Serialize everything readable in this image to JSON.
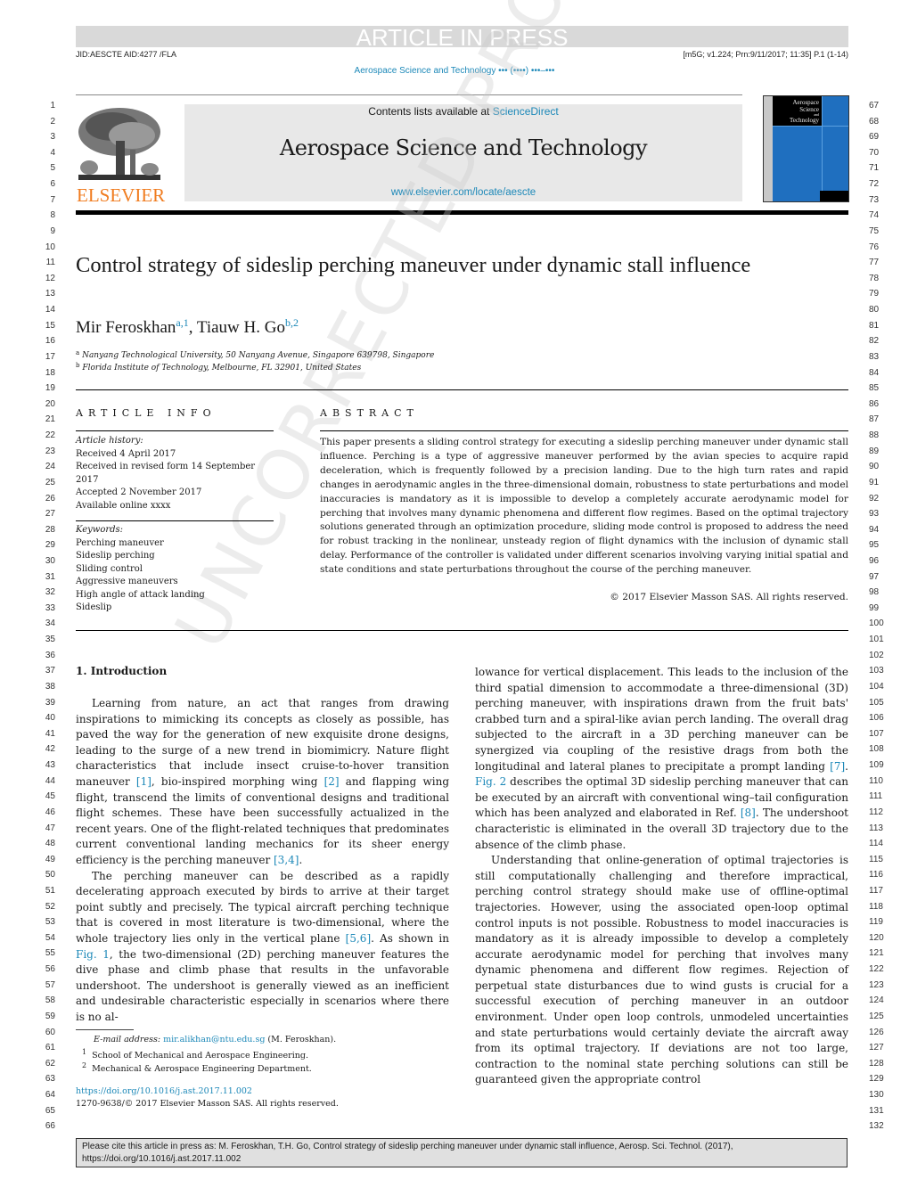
{
  "banner": "ARTICLE IN PRESS",
  "meta_left": "JID:AESCTE   AID:4277 /FLA",
  "meta_right": "[m5G; v1.224; Prn:9/11/2017; 11:35] P.1 (1-14)",
  "running_header": "Aerospace Science and Technology ••• (••••) •••–•••",
  "masthead": {
    "contents_prefix": "Contents lists available at ",
    "contents_link": "ScienceDirect",
    "journal_title": "Aerospace Science and Technology",
    "journal_url": "www.elsevier.com/locate/aescte",
    "publisher_logo": "ELSEVIER",
    "cover_title_1": "Aerospace",
    "cover_title_2": "Science",
    "cover_title_3": "and",
    "cover_title_4": "Technology",
    "publisher_color": "#f07c1f",
    "link_color": "#1c88b8"
  },
  "watermark": "UNCORRECTED PROOF",
  "article": {
    "title": "Control strategy of sideslip perching maneuver under dynamic stall influence",
    "authors": [
      {
        "name": "Mir Feroskhan",
        "sup": "a,1"
      },
      {
        "name": "Tiauw H. Go",
        "sup": "b,2"
      }
    ],
    "affiliations": [
      {
        "mark": "a",
        "text": "Nanyang Technological University, 50 Nanyang Avenue, Singapore 639798, Singapore"
      },
      {
        "mark": "b",
        "text": "Florida Institute of Technology, Melbourne, FL 32901, United States"
      }
    ]
  },
  "article_info": {
    "heading": "ARTICLE INFO",
    "history_label": "Article history:",
    "history": [
      "Received 4 April 2017",
      "Received in revised form 14 September 2017",
      "Accepted 2 November 2017",
      "Available online xxxx"
    ],
    "keywords_label": "Keywords:",
    "keywords": [
      "Perching maneuver",
      "Sideslip perching",
      "Sliding control",
      "Aggressive maneuvers",
      "High angle of attack landing",
      "Sideslip"
    ]
  },
  "abstract": {
    "heading": "ABSTRACT",
    "text": "This paper presents a sliding control strategy for executing a sideslip perching maneuver under dynamic stall influence. Perching is a type of aggressive maneuver performed by the avian species to acquire rapid deceleration, which is frequently followed by a precision landing. Due to the high turn rates and rapid changes in aerodynamic angles in the three-dimensional domain, robustness to state perturbations and model inaccuracies is mandatory as it is impossible to develop a completely accurate aerodynamic model for perching that involves many dynamic phenomena and different flow regimes. Based on the optimal trajectory solutions generated through an optimization procedure, sliding mode control is proposed to address the need for robust tracking in the nonlinear, unsteady region of flight dynamics with the inclusion of dynamic stall delay. Performance of the controller is validated under different scenarios involving varying initial spatial and state conditions and state perturbations throughout the course of the perching maneuver.",
    "copyright": "© 2017 Elsevier Masson SAS. All rights reserved."
  },
  "body": {
    "section_heading": "1. Introduction",
    "left_p1_a": "Learning from nature, an act that ranges from drawing inspirations to mimicking its concepts as closely as possible, has paved the way for the generation of new exquisite drone designs, leading to the surge of a new trend in biomimicry. Nature flight characteristics that include insect cruise-to-hover transition maneuver ",
    "ref1": "[1]",
    "left_p1_b": ", bio-inspired morphing wing ",
    "ref2": "[2]",
    "left_p1_c": " and flapping wing flight, transcend the limits of conventional designs and traditional flight schemes. These have been successfully actualized in the recent years. One of the flight-related techniques that predominates current conventional landing mechanics for its sheer energy efficiency is the perching maneuver ",
    "ref34": "[3,4]",
    "left_p1_d": ".",
    "left_p2_a": "The perching maneuver can be described as a rapidly decelerating approach executed by birds to arrive at their target point subtly and precisely. The typical aircraft perching technique that is covered in most literature is two-dimensional, where the whole trajectory lies only in the vertical plane ",
    "ref56": "[5,6]",
    "left_p2_b": ". As shown in ",
    "fig1": "Fig. 1",
    "left_p2_c": ", the two-dimensional (2D) perching maneuver features the dive phase and climb phase that results in the unfavorable undershoot. The undershoot is generally viewed as an inefficient and undesirable characteristic especially in scenarios where there is no al-",
    "right_p1_a": "lowance for vertical displacement. This leads to the inclusion of the third spatial dimension to accommodate a three-dimensional (3D) perching maneuver, with inspirations drawn from the fruit bats' crabbed turn and a spiral-like avian perch landing. The overall drag subjected to the aircraft in a 3D perching maneuver can be synergized via coupling of the resistive drags from both the longitudinal and lateral planes to precipitate a prompt landing ",
    "ref7": "[7]",
    "right_p1_b": ". ",
    "fig2": "Fig. 2",
    "right_p1_c": " describes the optimal 3D sideslip perching maneuver that can be executed by an aircraft with conventional wing–tail configuration which has been analyzed and elaborated in Ref. ",
    "ref8": "[8]",
    "right_p1_d": ". The undershoot characteristic is eliminated in the overall 3D trajectory due to the absence of the climb phase.",
    "right_p2": "Understanding that online-generation of optimal trajectories is still computationally challenging and therefore impractical, perching control strategy should make use of offline-optimal trajectories. However, using the associated open-loop optimal control inputs is not possible. Robustness to model inaccuracies is mandatory as it is already impossible to develop a completely accurate aerodynamic model for perching that involves many dynamic phenomena and different flow regimes. Rejection of perpetual state disturbances due to wind gusts is crucial for a successful execution of perching maneuver in an outdoor environment. Under open loop controls, unmodeled uncertainties and state perturbations would certainly deviate the aircraft away from its optimal trajectory. If deviations are not too large, contraction to the nominal state perching solutions can still be guaranteed given the appropriate control"
  },
  "footnotes": {
    "email_label": "E-mail address: ",
    "email": "mir.alikhan@ntu.edu.sg",
    "email_suffix": " (M. Feroskhan).",
    "fn1_mark": "1",
    "fn1": "School of Mechanical and Aerospace Engineering.",
    "fn2_mark": "2",
    "fn2": "Mechanical & Aerospace Engineering Department.",
    "doi": "https://doi.org/10.1016/j.ast.2017.11.002",
    "issn": "1270-9638/© 2017 Elsevier Masson SAS. All rights reserved."
  },
  "citation_box": {
    "line1": "Please cite this article in press as: M. Feroskhan, T.H. Go, Control strategy of sideslip perching maneuver under dynamic stall influence, Aerosp. Sci. Technol. (2017),",
    "line2": "https://doi.org/10.1016/j.ast.2017.11.002"
  },
  "line_numbers": {
    "left_start": 1,
    "left_end": 66,
    "right_start": 67,
    "right_end": 132
  }
}
